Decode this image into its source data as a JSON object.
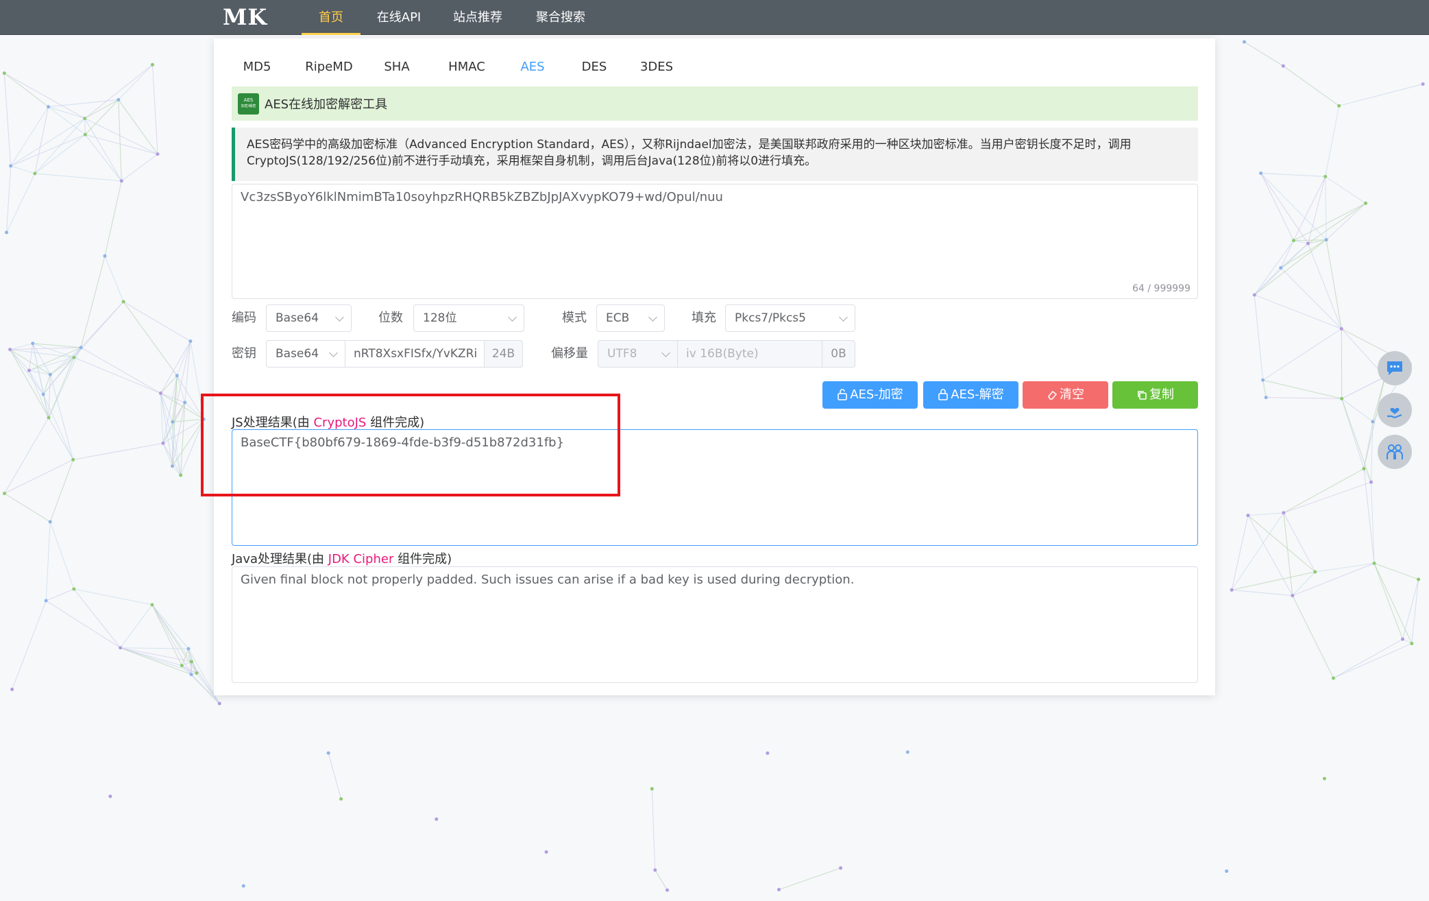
{
  "nav": {
    "logo": "MK",
    "items": [
      {
        "label": "首页",
        "active": true
      },
      {
        "label": "在线API",
        "active": false
      },
      {
        "label": "站点推荐",
        "active": false
      },
      {
        "label": "聚合搜索",
        "active": false
      }
    ]
  },
  "tabs": [
    "MD5",
    "RipeMD",
    "SHA",
    "HMAC",
    "AES",
    "DES",
    "3DES"
  ],
  "active_tab": "AES",
  "banner": {
    "icon_text_top": "AES",
    "icon_text_bottom": "加密/解密",
    "title": "AES在线加密解密工具"
  },
  "description": "AES密码学中的高级加密标准（Advanced Encryption Standard，AES），又称Rijndael加密法，是美国联邦政府采用的一种区块加密标准。当用户密钥长度不足时，调用CryptoJS(128/192/256位)前不进行手动填充，采用框架自身机制，调用后台Java(128位)前将以0进行填充。",
  "input": {
    "value": "Vc3zsSByoY6lklNmimBTa10soyhpzRHQRB5kZBZbJpJAXvypKO79+wd/Opul/nuu",
    "counter": "64 / 999999"
  },
  "options": {
    "encoding_label": "编码",
    "encoding_value": "Base64",
    "bits_label": "位数",
    "bits_value": "128位",
    "mode_label": "模式",
    "mode_value": "ECB",
    "padding_label": "填充",
    "padding_value": "Pkcs7/Pkcs5",
    "key_label": "密钥",
    "key_encoding": "Base64",
    "key_value": "nRT8XsxFISfx/YvKZRi",
    "key_size": "24B",
    "iv_label": "偏移量",
    "iv_encoding": "UTF8",
    "iv_placeholder": "iv 16B(Byte)",
    "iv_size": "0B"
  },
  "buttons": {
    "encrypt": "AES-加密",
    "decrypt": "AES-解密",
    "clear": "清空",
    "copy": "复制"
  },
  "js_result": {
    "label_prefix": "JS处理结果(由 ",
    "label_component": "CryptoJS",
    "label_suffix": " 组件完成)",
    "value": "BaseCTF{b80bf679-1869-4fde-b3f9-d51b872d31fb}"
  },
  "java_result": {
    "label_prefix": "Java处理结果(由 ",
    "label_component": "JDK Cipher",
    "label_suffix": " 组件完成)",
    "value": "Given final block not properly padded. Such issues can arise if a bad key is used during decryption."
  },
  "side_buttons": [
    "chat-icon",
    "hand-heart-icon",
    "people-icon"
  ],
  "colors": {
    "nav_bg": "#545c64",
    "nav_active": "#ffd04b",
    "primary": "#409eff",
    "danger": "#f56c6c",
    "success": "#67c23a",
    "highlight_box": "#e8151b"
  }
}
